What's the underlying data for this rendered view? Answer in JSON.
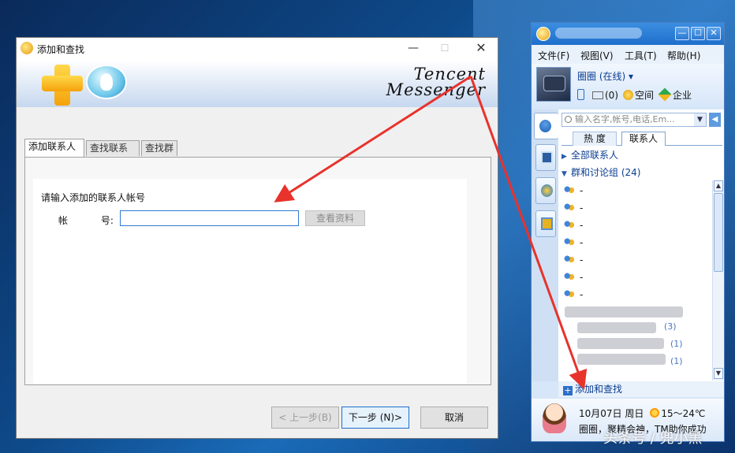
{
  "dialog": {
    "title": "添加和查找",
    "logo_line1": "Tencent",
    "logo_line2": "Messenger",
    "tabs": [
      "添加联系人",
      "查找联系人",
      "查找群"
    ],
    "active_tab": 0,
    "prompt": "请输入添加的联系人帐号",
    "account_label": "帐 号:",
    "account_value": "",
    "view_info_button": "查看资料",
    "prev_button": "< 上一步(B)",
    "next_button": "下一步 (N)>",
    "cancel_button": "取消"
  },
  "tm": {
    "menu": [
      "文件(F)",
      "视图(V)",
      "工具(T)",
      "帮助(H)"
    ],
    "nickname": "圈圈 (在线) ▾",
    "mail_count": "(0)",
    "space_label": "空间",
    "business_label": "企业",
    "search_placeholder": "输入名字,帐号,电话,Em...",
    "list_tabs": [
      "热 度",
      "联系人"
    ],
    "groups": {
      "all": "全部联系人",
      "groups_and_discussions": "群和讨论组 (24)"
    },
    "contacts": [
      "-",
      "-",
      "-",
      "-",
      "-",
      "-",
      "-"
    ],
    "badges": [
      "(3)",
      "(1)",
      "(1)"
    ],
    "add_find": "添加和查找",
    "date_line": "10月07日 周日",
    "weather": "15～24℃",
    "tip": "圈圈，聚精会神，TM助你成功"
  },
  "watermark": "头条号 / 兜小黑",
  "colors": {
    "annotation_arrow": "#e8322c",
    "focus_border": "#2f7bd1",
    "tm_title": "#1e6fcc"
  }
}
